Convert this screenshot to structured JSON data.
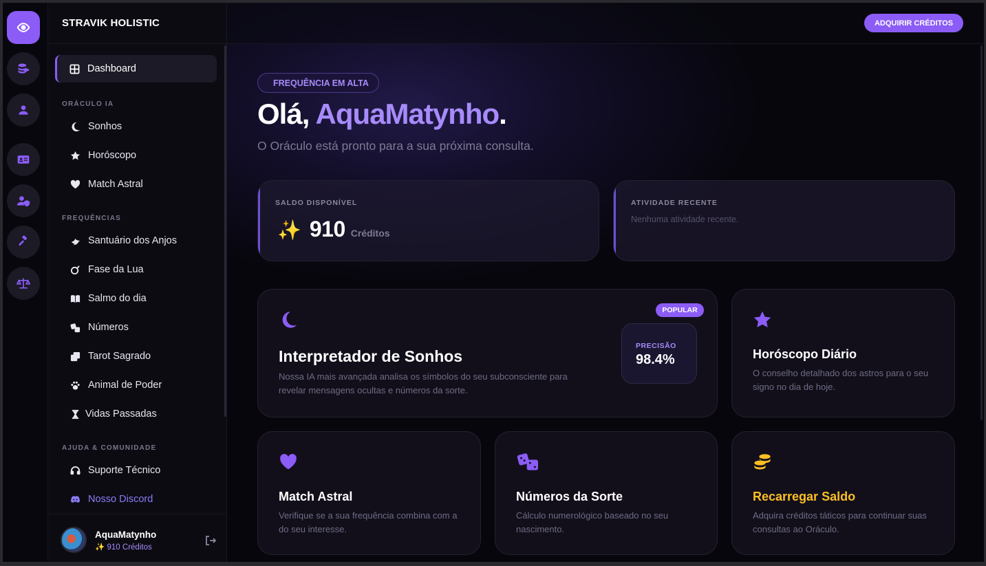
{
  "brand": "STRAVIK HOLISTIC",
  "header": {
    "buy_label": "ADQUIRIR CRÉDITOS"
  },
  "rail": [
    "eye-icon",
    "coins-icon",
    "user-icon",
    "id-card-icon",
    "user-shield-icon",
    "gavel-icon",
    "scales-icon"
  ],
  "sidebar": {
    "dashboard": "Dashboard",
    "sections": {
      "oraculo": "ORÁCULO IA",
      "frequencias": "FREQUÊNCIAS",
      "ajuda": "AJUDA & COMUNIDADE"
    },
    "oraculo_items": [
      "Sonhos",
      "Horóscopo",
      "Match Astral"
    ],
    "frequencias_items": [
      "Santuário dos Anjos",
      "Fase da Lua",
      "Salmo do dia",
      "Números",
      "Tarot Sagrado",
      "Animal de Poder",
      "Vidas Passadas"
    ],
    "ajuda_items": [
      "Suporte Técnico",
      "Nosso Discord"
    ]
  },
  "user": {
    "name": "AquaMatynho",
    "credits": "✨ 910 Créditos"
  },
  "hero": {
    "pill": "FREQUÊNCIA EM ALTA",
    "greeting": "Olá,",
    "name": "AquaMatynho",
    "dot": ".",
    "subtitle": "O Oráculo está pronto para a sua próxima consulta."
  },
  "stats": {
    "balance_label": "SALDO DISPONÍVEL",
    "balance_icon": "✨",
    "balance_value": "910",
    "balance_unit": "Créditos",
    "activity_label": "ATIVIDADE RECENTE",
    "activity_empty": "Nenhuma atividade recente."
  },
  "features": {
    "dreams": {
      "badge": "POPULAR",
      "title": "Interpretador de Sonhos",
      "desc": "Nossa IA mais avançada analisa os símbolos do seu subconsciente para revelar mensagens ocultas e números da sorte.",
      "precision_label": "PRECISÃO",
      "precision_value": "98.4%"
    },
    "horoscope": {
      "title": "Horóscopo Diário",
      "desc": "O conselho detalhado dos astros para o seu signo no dia de hoje."
    },
    "match": {
      "title": "Match Astral",
      "desc": "Verifique se a sua frequência combina com a do seu interesse."
    },
    "numbers": {
      "title": "Números da Sorte",
      "desc": "Cálculo numerológico baseado no seu nascimento."
    },
    "recharge": {
      "title": "Recarregar Saldo",
      "desc": "Adquira créditos táticos para continuar suas consultas ao Oráculo."
    }
  },
  "colors": {
    "accent": "#8b5cf6",
    "accent_light": "#a78bfa",
    "gold": "#fbbf24",
    "background": "#07060c"
  }
}
